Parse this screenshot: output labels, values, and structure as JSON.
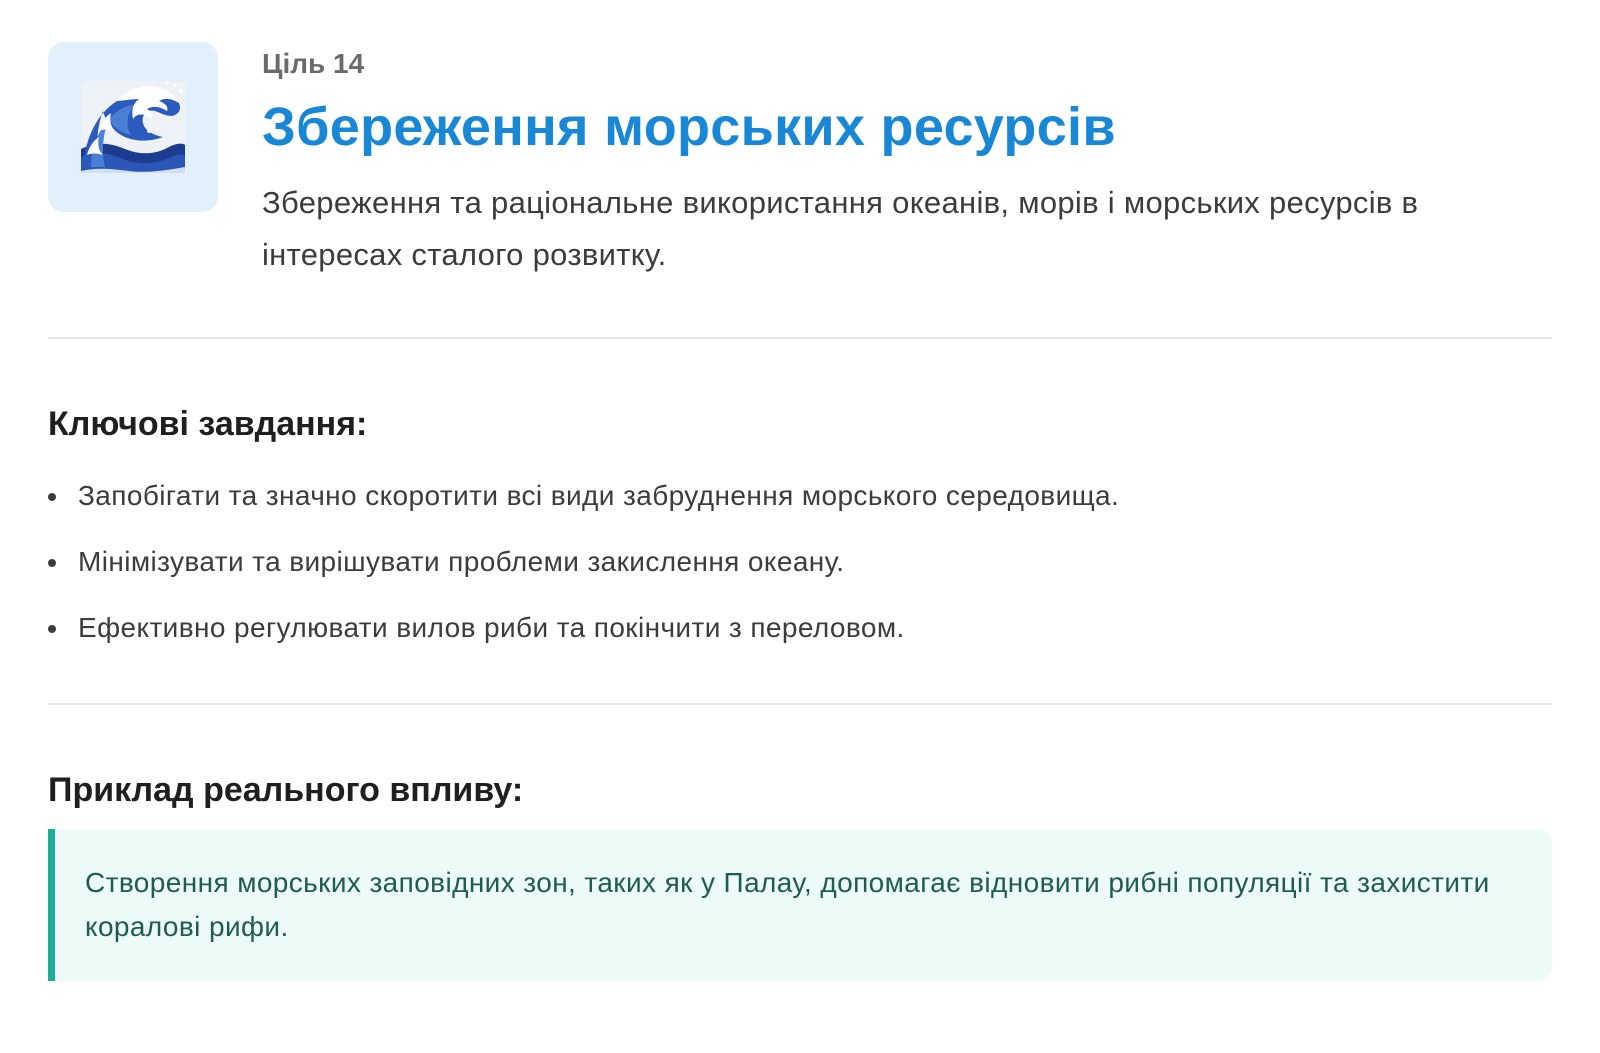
{
  "goal": {
    "icon": "water-wave-icon",
    "number_label": "Ціль 14",
    "title": "Збереження морських ресурсів",
    "description": "Збереження та раціональне використання океанів, морів і морських ресурсів в інтересах сталого розвитку."
  },
  "key_tasks": {
    "heading": "Ключові завдання:",
    "items": [
      "Запобігати та значно скоротити всі види забруднення морського середовища.",
      "Мінімізувати та вирішувати проблеми закислення океану.",
      "Ефективно регулювати вилов риби та покінчити з переловом."
    ]
  },
  "impact": {
    "heading": "Приклад реального впливу:",
    "text": "Створення морських заповідних зон, таких як у Палау, допомагає відновити рибні популяції та захистити коралові рифи."
  },
  "colors": {
    "accent": "#1787d6",
    "icon_bg": "#e1f0fb",
    "impact_border": "#1fae95",
    "impact_bg": "#ecfbf7",
    "impact_text": "#1f5c4f"
  }
}
